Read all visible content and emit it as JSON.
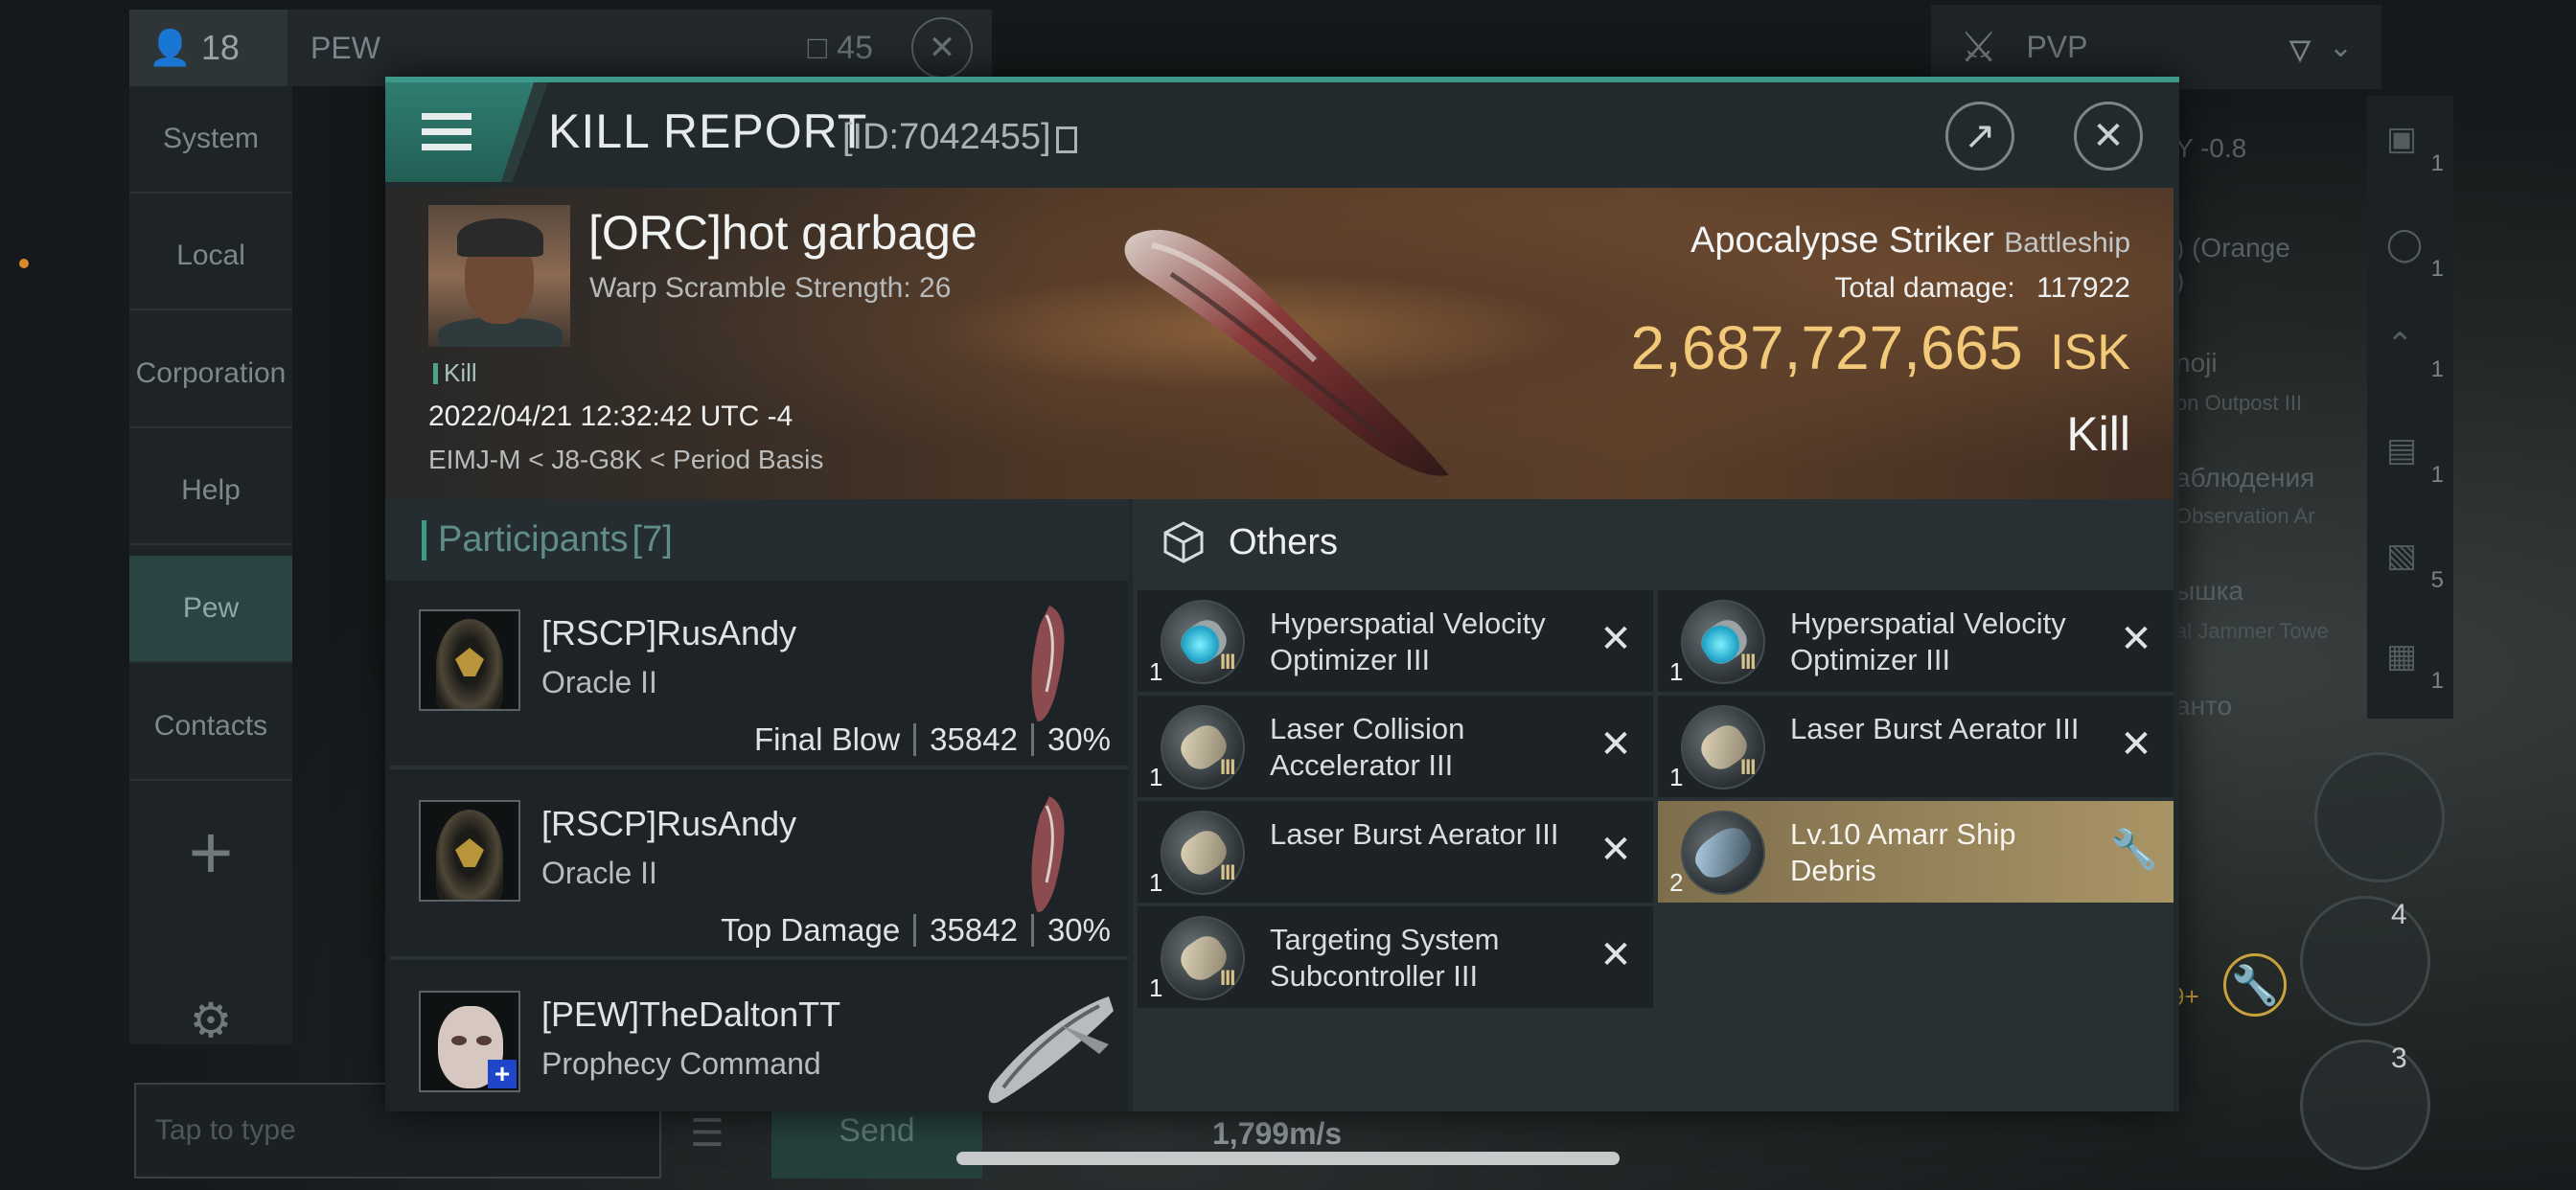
{
  "chat": {
    "member_icon_count": "18",
    "channel_name": "PEW",
    "window_count": "45",
    "sidebar": [
      "System",
      "Local",
      "Corporation",
      "Help",
      "Pew",
      "Contacts"
    ],
    "input_placeholder": "Tap to type",
    "send_label": "Send"
  },
  "hud": {
    "speed": "1,799m/s",
    "filter_label": "PVP",
    "overview_rows": [
      "Y -0.8",
      ") (Orange",
      ")",
      "noji",
      "on Outpost III",
      "аблюдения",
      "Observation Ar",
      "ышка",
      "al Jammer Towe",
      "анто"
    ],
    "overview_counts": [
      "1",
      "1",
      "1",
      "1",
      "5",
      "1"
    ],
    "module_counts": [
      "4",
      "3"
    ],
    "module_badge": "9+"
  },
  "report": {
    "title": "KILL REPORT",
    "id": "[ID:7042455]",
    "victim_name": "[ORC]hot garbage",
    "warp_strength": "Warp Scramble Strength: 26",
    "kill_tag": "Kill",
    "datetime": "2022/04/21 12:32:42 UTC -4",
    "location": "EIMJ-M < J8-G8K < Period Basis",
    "ship_name": "Apocalypse Striker",
    "ship_class": "Battleship",
    "total_damage_label": "Total damage:",
    "total_damage": "117922",
    "isk_value": "2,687,727,665",
    "isk_unit": "ISK",
    "result": "Kill"
  },
  "participants": {
    "title": "Participants",
    "count": "[7]",
    "rows": [
      {
        "name": "[RSCP]RusAndy",
        "ship": "Oracle II",
        "tag": "Final Blow",
        "damage": "35842",
        "percent": "30%"
      },
      {
        "name": "[RSCP]RusAndy",
        "ship": "Oracle II",
        "tag": "Top Damage",
        "damage": "35842",
        "percent": "30%"
      },
      {
        "name": "[PEW]TheDaltonTT",
        "ship": "Prophecy Command"
      }
    ]
  },
  "others": {
    "title": "Others",
    "items": [
      {
        "qty": "1",
        "name": "Hyperspatial Velocity Optimizer III",
        "tech": "III"
      },
      {
        "qty": "1",
        "name": "Hyperspatial Velocity Optimizer III",
        "tech": "III"
      },
      {
        "qty": "1",
        "name": "Laser Collision Accelerator III",
        "tech": "III"
      },
      {
        "qty": "1",
        "name": "Laser Burst Aerator III",
        "tech": "III"
      },
      {
        "qty": "1",
        "name": "Laser Burst Aerator III",
        "tech": "III"
      },
      {
        "qty": "2",
        "name": "Lv.10 Amarr Ship Debris"
      },
      {
        "qty": "1",
        "name": "Targeting System Subcontroller III",
        "tech": "III"
      }
    ]
  }
}
